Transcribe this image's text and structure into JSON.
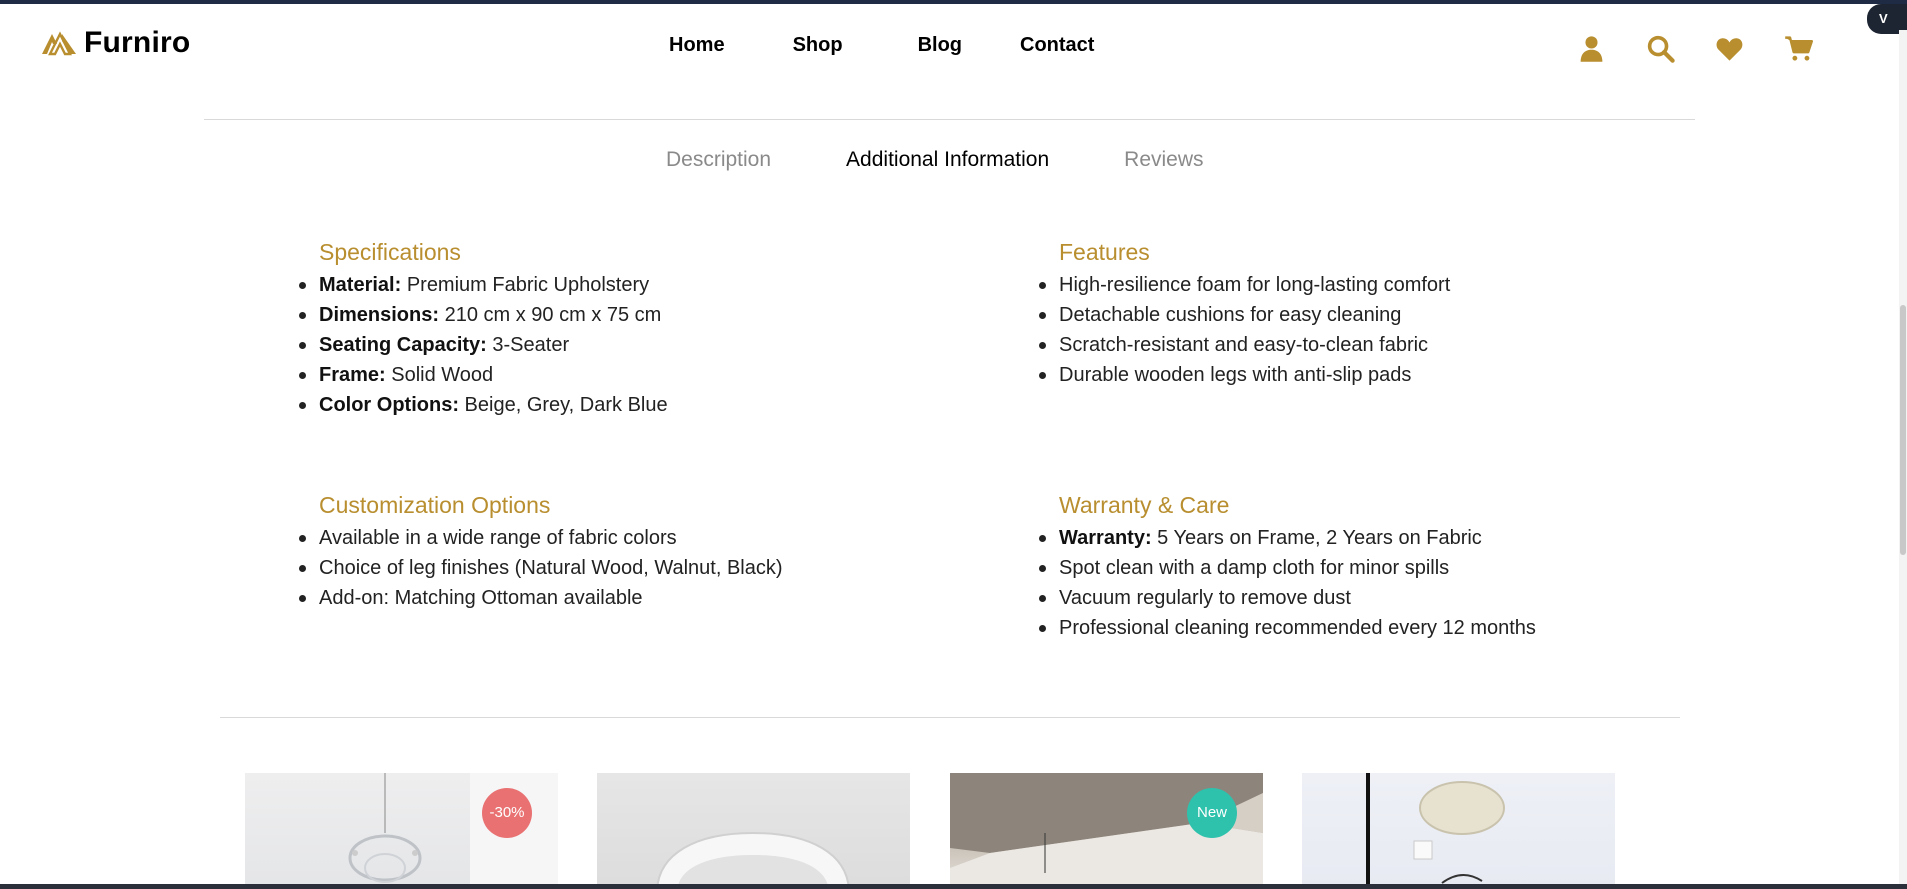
{
  "brand": {
    "name": "Furniro",
    "accent_color": "#b88e2f"
  },
  "nav": {
    "items": [
      {
        "label": "Home"
      },
      {
        "label": "Shop"
      },
      {
        "label": "Blog"
      },
      {
        "label": "Contact"
      }
    ]
  },
  "header_icons": [
    "user-icon",
    "search-icon",
    "heart-icon",
    "cart-icon"
  ],
  "corner_badge": "V",
  "tabs": [
    {
      "label": "Description",
      "active": false
    },
    {
      "label": "Additional Information",
      "active": true
    },
    {
      "label": "Reviews",
      "active": false
    }
  ],
  "sections": {
    "specifications": {
      "title": "Specifications",
      "items": [
        {
          "label": "Material:",
          "value": "Premium Fabric Upholstery"
        },
        {
          "label": "Dimensions:",
          "value": "210 cm x 90 cm x 75 cm"
        },
        {
          "label": "Seating Capacity:",
          "value": "3-Seater"
        },
        {
          "label": "Frame:",
          "value": "Solid Wood"
        },
        {
          "label": "Color Options:",
          "value": "Beige, Grey, Dark Blue"
        }
      ]
    },
    "features": {
      "title": "Features",
      "items": [
        "High-resilience foam for long-lasting comfort",
        "Detachable cushions for easy cleaning",
        "Scratch-resistant and easy-to-clean fabric",
        "Durable wooden legs with anti-slip pads"
      ]
    },
    "customization": {
      "title": "Customization Options",
      "items": [
        "Available in a wide range of fabric colors",
        "Choice of leg finishes (Natural Wood, Walnut, Black)",
        "Add-on: Matching Ottoman available"
      ]
    },
    "warranty": {
      "title": "Warranty & Care",
      "items": [
        {
          "label": "Warranty:",
          "value": "5 Years on Frame, 2 Years on Fabric"
        },
        {
          "label": "",
          "value": "Spot clean with a damp cloth for minor spills"
        },
        {
          "label": "",
          "value": "Vacuum regularly to remove dust"
        },
        {
          "label": "",
          "value": "Professional cleaning recommended every 12 months"
        }
      ]
    }
  },
  "products": [
    {
      "badge": "-30%",
      "badge_color": "#e97171"
    },
    {
      "badge": null
    },
    {
      "badge": "New",
      "badge_color": "#2ec1ac"
    },
    {
      "badge": null
    }
  ]
}
